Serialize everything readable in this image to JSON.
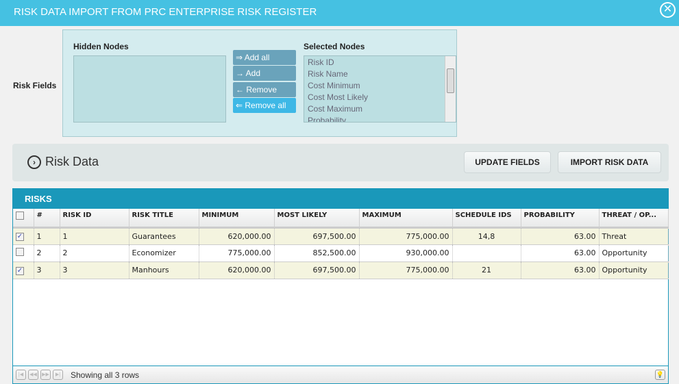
{
  "title": "RISK DATA IMPORT FROM PRC ENTERPRISE RISK REGISTER",
  "risk_fields_label": "Risk Fields",
  "hidden_nodes_label": "Hidden Nodes",
  "selected_nodes_label": "Selected Nodes",
  "buttons": {
    "add_all": "⇒ Add all",
    "add": "→ Add",
    "remove": "← Remove",
    "remove_all": "⇐ Remove all",
    "update_fields": "UPDATE FIELDS",
    "import": "IMPORT RISK DATA"
  },
  "selected_nodes": [
    "Risk ID",
    "Risk Name",
    "Cost Minimum",
    "Cost Most Likely",
    "Cost Maximum",
    "Probability"
  ],
  "section_title": "Risk Data",
  "grid": {
    "title": "RISKS",
    "columns": [
      "#",
      "RISK ID",
      "RISK TITLE",
      "MINIMUM",
      "MOST LIKELY",
      "MAXIMUM",
      "SCHEDULE IDS",
      "PROBABILITY",
      "THREAT / OP..."
    ],
    "rows": [
      {
        "checked": true,
        "num": "1",
        "id": "1",
        "title": "Guarantees",
        "min": "620,000.00",
        "ml": "697,500.00",
        "max": "775,000.00",
        "sched": "14,8",
        "prob": "63.00",
        "type": "Threat"
      },
      {
        "checked": false,
        "num": "2",
        "id": "2",
        "title": "Economizer",
        "min": "775,000.00",
        "ml": "852,500.00",
        "max": "930,000.00",
        "sched": "",
        "prob": "63.00",
        "type": "Opportunity"
      },
      {
        "checked": true,
        "num": "3",
        "id": "3",
        "title": "Manhours",
        "min": "620,000.00",
        "ml": "697,500.00",
        "max": "775,000.00",
        "sched": "21",
        "prob": "63.00",
        "type": "Opportunity"
      }
    ],
    "status": "Showing all 3 rows"
  },
  "colors": {
    "titlebar": "#45c1e2",
    "grid_header": "#1a98ba",
    "odd_row": "#f4f4df"
  }
}
